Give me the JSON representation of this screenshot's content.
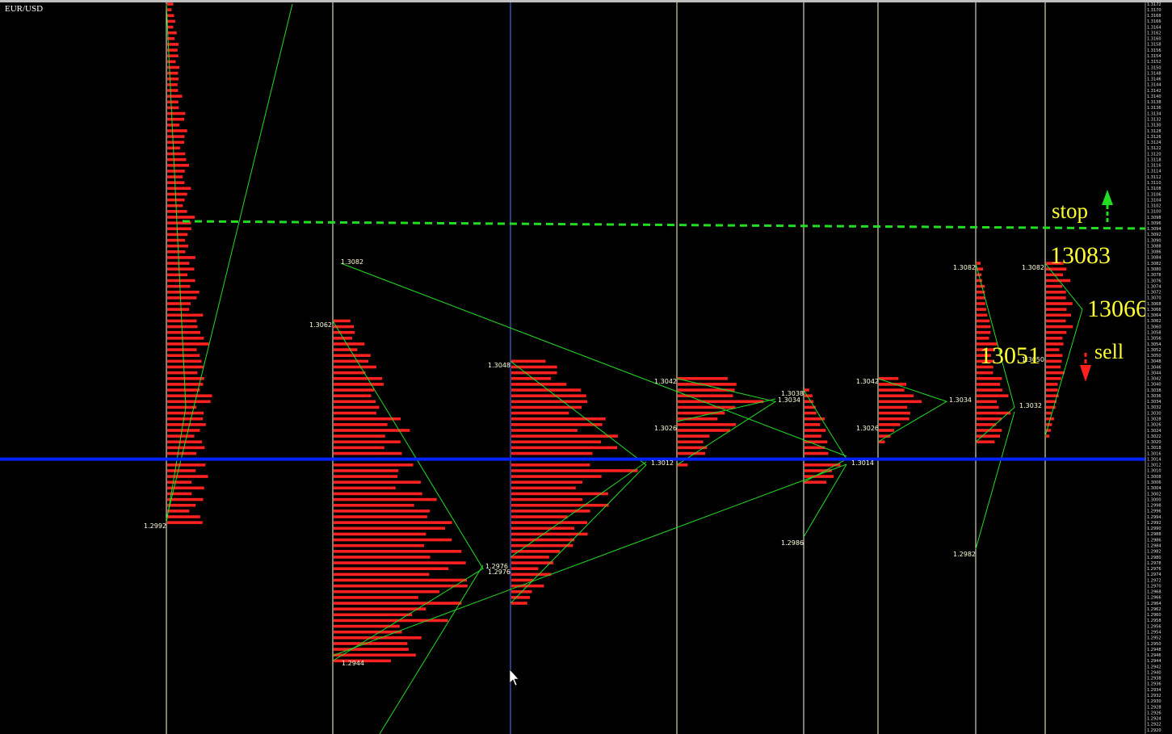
{
  "header": {
    "symbol": "EUR/USD"
  },
  "colors": {
    "background": "#000000",
    "tpo": "#ff2020",
    "profile_line": "#22dd22",
    "session_divider": "#ffffe0",
    "horizontal_level": "#0022ff",
    "stop_line": "#22dd22",
    "annotation_text": "#ffff33",
    "stop_arrow": "#22dd22",
    "sell_arrow": "#ff2020"
  },
  "chart_data": {
    "type": "market-profile",
    "y_axis": {
      "min": 1.292,
      "max": 1.3172,
      "step": 0.0002,
      "position": "right"
    },
    "horizontal_level": 1.3014,
    "stop_level": 1.3094,
    "sessions": [
      {
        "low": 1.2992,
        "high": 1.3172,
        "poc": 1.3032,
        "labels": [
          "1.2992"
        ]
      },
      {
        "low": 1.2944,
        "high": 1.3062,
        "poc": 1.2976,
        "labels": [
          "1.3082",
          "1.3062",
          "1.2944",
          "1.2976"
        ]
      },
      {
        "low": 1.2964,
        "high": 1.3048,
        "poc": 1.3012,
        "labels": [
          "1.3048",
          "1.2976",
          "1.3012"
        ]
      },
      {
        "low": 1.3012,
        "high": 1.3042,
        "poc": 1.3034,
        "labels": [
          "1.3042",
          "1.3026",
          "1.3034"
        ]
      },
      {
        "low": 1.3006,
        "high": 1.3038,
        "poc": 1.3014,
        "labels": [
          "1.3038",
          "1.2986",
          "1.3014"
        ]
      },
      {
        "low": 1.302,
        "high": 1.3042,
        "poc": 1.3034,
        "labels": [
          "1.3042",
          "1.3026",
          "1.3034"
        ]
      },
      {
        "low": 1.302,
        "high": 1.3082,
        "poc": 1.3032,
        "labels": [
          "1.3082",
          "1.2982",
          "1.3032"
        ]
      },
      {
        "low": 1.3022,
        "high": 1.3082,
        "poc": 1.3066,
        "labels": [
          "1.3082",
          "1.3050"
        ]
      }
    ],
    "annotations": [
      {
        "text": "stop",
        "price": 1.3098
      },
      {
        "text": "13083",
        "price": 1.3084
      },
      {
        "text": "13066",
        "price": 1.3066
      },
      {
        "text": "13051",
        "price": 1.3046
      },
      {
        "text": "sell",
        "price": 1.3048
      }
    ]
  }
}
